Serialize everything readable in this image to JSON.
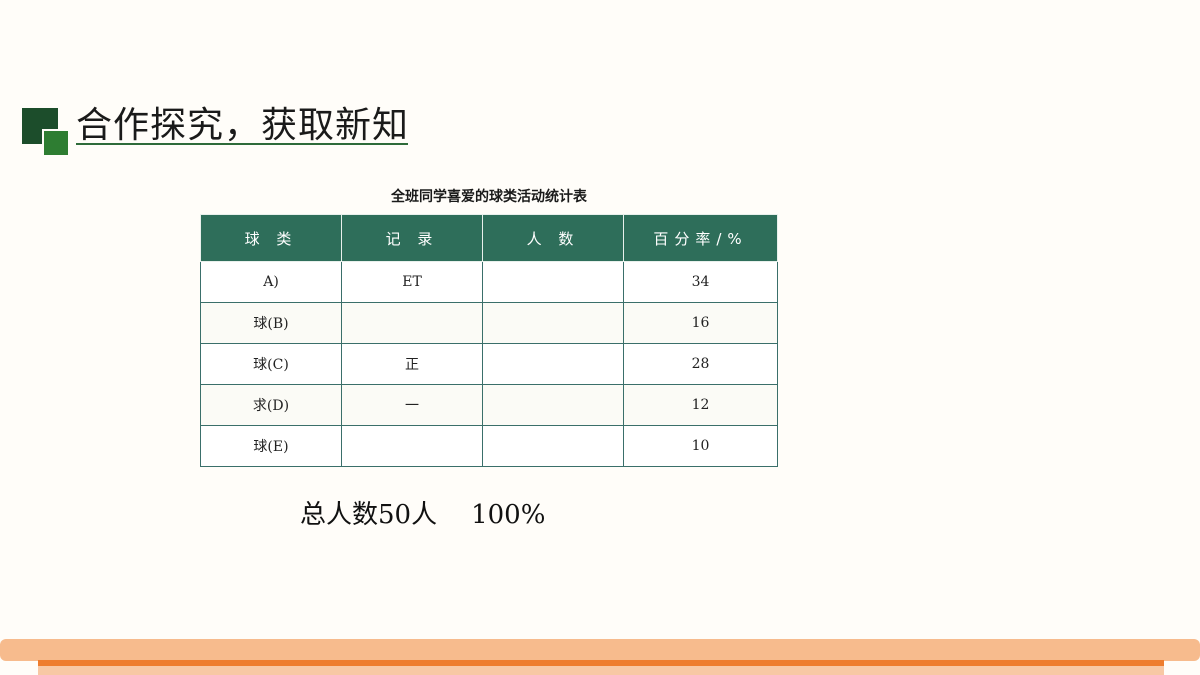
{
  "slide": {
    "title": "合作探究，获取新知",
    "accent_dark": "#1c4d2b",
    "accent_light": "#2e7d32"
  },
  "table": {
    "caption": "全班同学喜爱的球类活动统计表",
    "headers": [
      "球 类",
      "记 录",
      "人 数",
      "百分率/%"
    ],
    "rows": [
      [
        "A)",
        "ET",
        "",
        "34"
      ],
      [
        "球(B)",
        "",
        "",
        "16"
      ],
      [
        "球(C)",
        "正",
        "",
        "28"
      ],
      [
        "求(D)",
        "一",
        "",
        "12"
      ],
      [
        "球(E)",
        "",
        "",
        "10"
      ]
    ],
    "header_color": "#2e6e5a"
  },
  "total": {
    "label": "总人数50人",
    "percent": "100%"
  },
  "footer": {
    "bar_color_light": "#f7bb8d",
    "bar_color_dark": "#ee7d2e"
  }
}
